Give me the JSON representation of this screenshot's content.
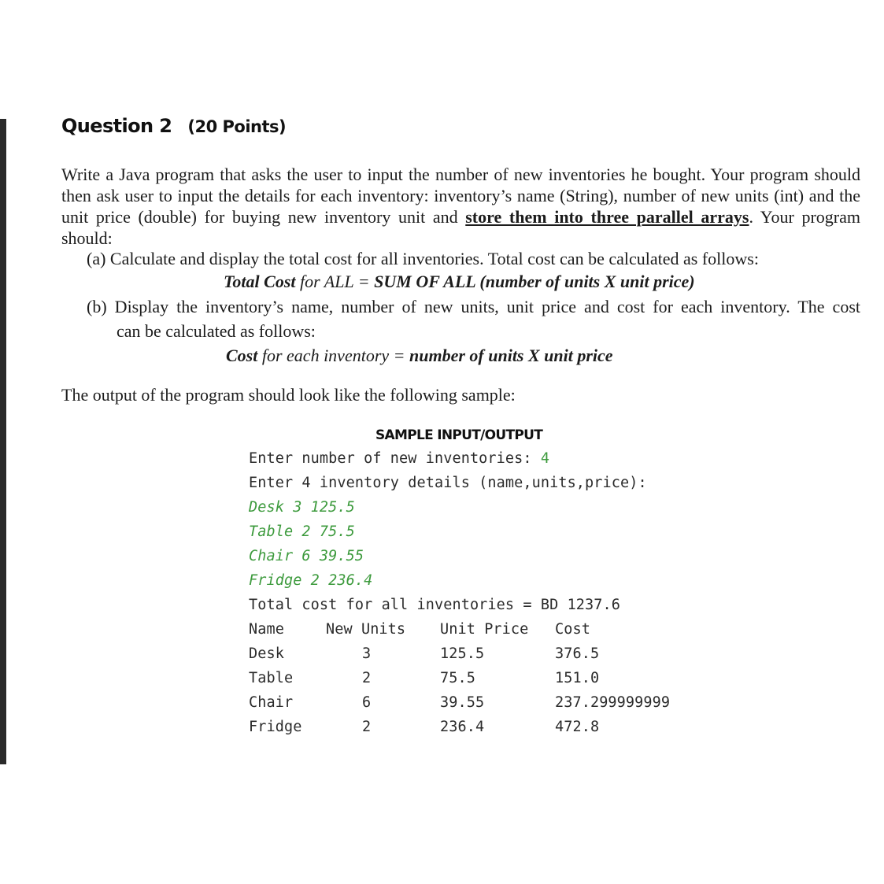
{
  "question": {
    "title": "Question 2",
    "points": "(20 Points)"
  },
  "intro": {
    "text_before": "Write a Java program that asks the user to input the number of new inventories he bought. Your program should then ask user to input the details for each inventory: inventory’s name (String), number of new units (int) and the unit price (double) for buying new inventory unit and ",
    "emphasis": "store them into three parallel arrays",
    "text_after": ". Your program should:"
  },
  "items": {
    "a": {
      "label": "(a) Calculate and display the total cost for all inventories. Total cost can be calculated as follows:",
      "formula_bold1": "Total Cost",
      "formula_italic": " for ALL = ",
      "formula_bold2": "SUM OF ALL (number of units X unit price)"
    },
    "b": {
      "label_line1": "(b) Display the inventory’s name, number of new units, unit price and cost for each inventory. The cost",
      "label_line2": "can be calculated as follows:",
      "formula_bold1": "Cost",
      "formula_italic": " for each inventory = ",
      "formula_bold2": "number of units X unit price"
    }
  },
  "sample_intro": "The output of the program should look like the following sample:",
  "sample": {
    "title": "SAMPLE INPUT/OUTPUT",
    "prompt1": "Enter number of new inventories: ",
    "prompt1_input": "4",
    "prompt2": "Enter 4 inventory details (name,units,price):",
    "inputs": [
      "Desk 3 125.5",
      "Table 2 75.5",
      "Chair 6 39.55",
      "Fridge 2 236.4"
    ],
    "total_line": "Total cost for all inventories = BD 1237.6",
    "table": {
      "headers": [
        "Name",
        "New Units",
        "Unit Price",
        "Cost"
      ],
      "rows": [
        [
          "Desk",
          "3",
          "125.5",
          "376.5"
        ],
        [
          "Table",
          "2",
          "75.5",
          "151.0"
        ],
        [
          "Chair",
          "6",
          "39.55",
          "237.299999999"
        ],
        [
          "Fridge",
          "2",
          "236.4",
          "472.8"
        ]
      ]
    }
  },
  "colors": {
    "user_input": "#3c9a3c",
    "side_bar": "#2a2a2a"
  }
}
